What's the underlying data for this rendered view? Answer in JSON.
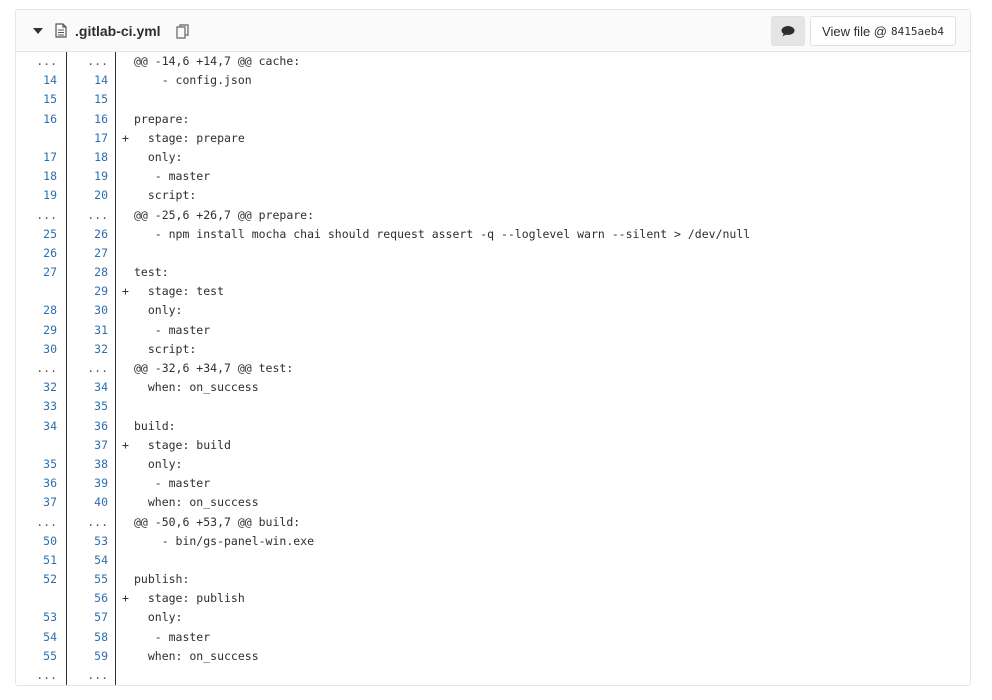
{
  "file": {
    "name": ".gitlab-ci.yml",
    "view_file_label": "View file @",
    "sha": "8415aeb4"
  },
  "icons": {
    "toggle": "caret-down-icon",
    "file": "file-text-icon",
    "copy": "copy-icon",
    "comment": "comment-icon"
  },
  "lines": [
    {
      "type": "match",
      "old": "...",
      "new": "...",
      "marker": "",
      "text": "@@ -14,6 +14,7 @@ cache:"
    },
    {
      "type": "context",
      "old": "14",
      "new": "14",
      "marker": "",
      "text": "    - config.json"
    },
    {
      "type": "context",
      "old": "15",
      "new": "15",
      "marker": "",
      "text": ""
    },
    {
      "type": "context",
      "old": "16",
      "new": "16",
      "marker": "",
      "text": "prepare:"
    },
    {
      "type": "added",
      "old": "",
      "new": "17",
      "marker": "+",
      "text": "  stage: prepare"
    },
    {
      "type": "context",
      "old": "17",
      "new": "18",
      "marker": "",
      "text": "  only:"
    },
    {
      "type": "context",
      "old": "18",
      "new": "19",
      "marker": "",
      "text": "   - master"
    },
    {
      "type": "context",
      "old": "19",
      "new": "20",
      "marker": "",
      "text": "  script:"
    },
    {
      "type": "match",
      "old": "...",
      "new": "...",
      "marker": "",
      "text": "@@ -25,6 +26,7 @@ prepare:"
    },
    {
      "type": "context",
      "old": "25",
      "new": "26",
      "marker": "",
      "text": "   - npm install mocha chai should request assert -q --loglevel warn --silent > /dev/null"
    },
    {
      "type": "context",
      "old": "26",
      "new": "27",
      "marker": "",
      "text": ""
    },
    {
      "type": "context",
      "old": "27",
      "new": "28",
      "marker": "",
      "text": "test:"
    },
    {
      "type": "added",
      "old": "",
      "new": "29",
      "marker": "+",
      "text": "  stage: test"
    },
    {
      "type": "context",
      "old": "28",
      "new": "30",
      "marker": "",
      "text": "  only:"
    },
    {
      "type": "context",
      "old": "29",
      "new": "31",
      "marker": "",
      "text": "   - master"
    },
    {
      "type": "context",
      "old": "30",
      "new": "32",
      "marker": "",
      "text": "  script:"
    },
    {
      "type": "match",
      "old": "...",
      "new": "...",
      "marker": "",
      "text": "@@ -32,6 +34,7 @@ test:"
    },
    {
      "type": "context",
      "old": "32",
      "new": "34",
      "marker": "",
      "text": "  when: on_success"
    },
    {
      "type": "context",
      "old": "33",
      "new": "35",
      "marker": "",
      "text": ""
    },
    {
      "type": "context",
      "old": "34",
      "new": "36",
      "marker": "",
      "text": "build:"
    },
    {
      "type": "added",
      "old": "",
      "new": "37",
      "marker": "+",
      "text": "  stage: build"
    },
    {
      "type": "context",
      "old": "35",
      "new": "38",
      "marker": "",
      "text": "  only:"
    },
    {
      "type": "context",
      "old": "36",
      "new": "39",
      "marker": "",
      "text": "   - master"
    },
    {
      "type": "context",
      "old": "37",
      "new": "40",
      "marker": "",
      "text": "  when: on_success"
    },
    {
      "type": "match",
      "old": "...",
      "new": "...",
      "marker": "",
      "text": "@@ -50,6 +53,7 @@ build:"
    },
    {
      "type": "context",
      "old": "50",
      "new": "53",
      "marker": "",
      "text": "    - bin/gs-panel-win.exe"
    },
    {
      "type": "context",
      "old": "51",
      "new": "54",
      "marker": "",
      "text": ""
    },
    {
      "type": "context",
      "old": "52",
      "new": "55",
      "marker": "",
      "text": "publish:"
    },
    {
      "type": "added",
      "old": "",
      "new": "56",
      "marker": "+",
      "text": "  stage: publish"
    },
    {
      "type": "context",
      "old": "53",
      "new": "57",
      "marker": "",
      "text": "  only:"
    },
    {
      "type": "context",
      "old": "54",
      "new": "58",
      "marker": "",
      "text": "   - master"
    },
    {
      "type": "context",
      "old": "55",
      "new": "59",
      "marker": "",
      "text": "  when: on_success"
    },
    {
      "type": "match",
      "old": "...",
      "new": "...",
      "marker": "",
      "text": ""
    }
  ]
}
